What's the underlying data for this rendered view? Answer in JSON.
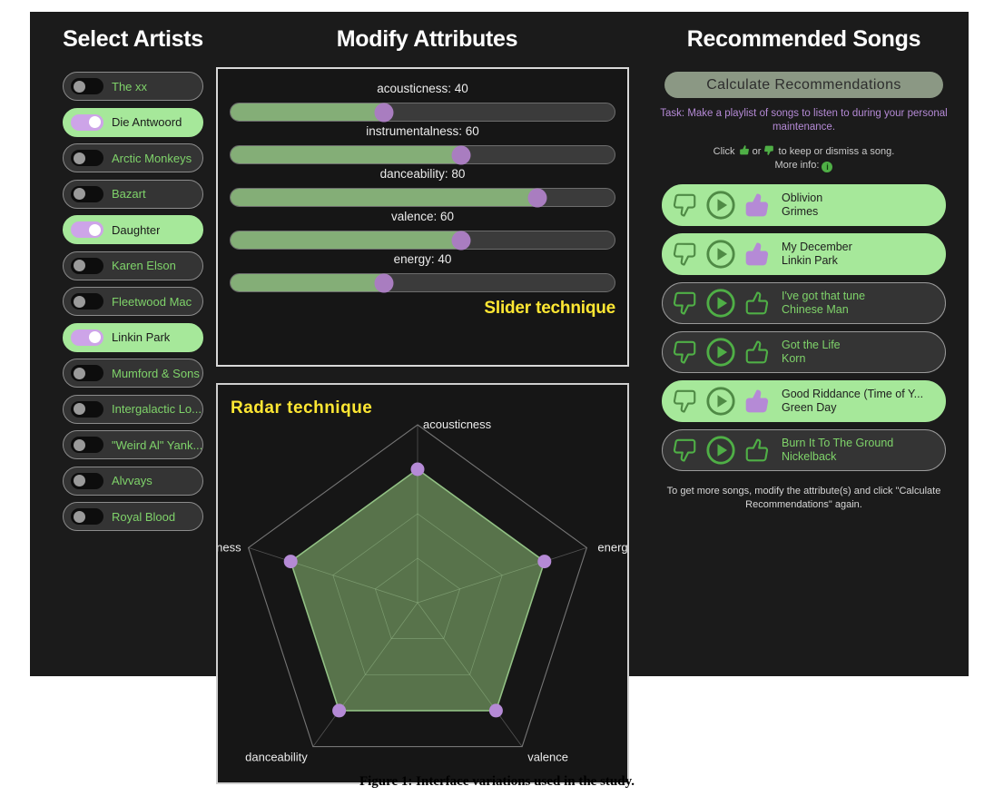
{
  "columns": {
    "artists_title": "Select Artists",
    "attributes_title": "Modify Attributes",
    "recommendations_title": "Recommended Songs"
  },
  "artists": [
    {
      "name": "The xx",
      "selected": false
    },
    {
      "name": "Die Antwoord",
      "selected": true
    },
    {
      "name": "Arctic Monkeys",
      "selected": false
    },
    {
      "name": "Bazart",
      "selected": false
    },
    {
      "name": "Daughter",
      "selected": true
    },
    {
      "name": "Karen Elson",
      "selected": false
    },
    {
      "name": "Fleetwood Mac",
      "selected": false
    },
    {
      "name": "Linkin Park",
      "selected": true
    },
    {
      "name": "Mumford & Sons",
      "selected": false
    },
    {
      "name": "Intergalactic Lo...",
      "selected": false
    },
    {
      "name": "\"Weird Al\" Yank...",
      "selected": false
    },
    {
      "name": "Alvvays",
      "selected": false
    },
    {
      "name": "Royal Blood",
      "selected": false
    }
  ],
  "sliders": {
    "technique_tag": "Slider technique",
    "items": [
      {
        "label": "acousticness: 40",
        "attribute": "acousticness",
        "value": 40
      },
      {
        "label": "instrumentalness: 60",
        "attribute": "instrumentalness",
        "value": 60
      },
      {
        "label": "danceability: 80",
        "attribute": "danceability",
        "value": 80
      },
      {
        "label": "valence: 60",
        "attribute": "valence",
        "value": 60
      },
      {
        "label": "energy: 40",
        "attribute": "energy",
        "value": 40
      }
    ]
  },
  "radar": {
    "technique_tag": "Radar  technique"
  },
  "chart_data": {
    "type": "radar",
    "title": "Radar  technique",
    "categories": [
      "acousticness",
      "energy",
      "valence",
      "danceability",
      "instrumentalness"
    ],
    "values": [
      75,
      75,
      75,
      75,
      75
    ],
    "rings": 4,
    "range": [
      0,
      100
    ],
    "grid": true,
    "legend": "none",
    "fill_color": "#5f7d51",
    "stroke_color": "#8fc080",
    "point_color": "#b58ad6",
    "axis_color": "#7a7a7a"
  },
  "recommendations": {
    "calculate_label": "Calculate Recommendations",
    "task_text": "Task: Make a playlist of songs to listen to during your personal maintenance.",
    "click_help_prefix": "Click",
    "click_help_middle": "or",
    "click_help_suffix": "to keep or dismiss a song.",
    "more_info_label": "More info:",
    "info_glyph": "i",
    "footer_note": "To get more songs, modify the attribute(s) and click \"Calculate Recommendations\" again.",
    "songs": [
      {
        "title": "Oblivion",
        "artist": "Grimes",
        "liked": true
      },
      {
        "title": "My December",
        "artist": "Linkin Park",
        "liked": true
      },
      {
        "title": "I've got that tune",
        "artist": "Chinese Man",
        "liked": false
      },
      {
        "title": "Got the Life",
        "artist": "Korn",
        "liked": false
      },
      {
        "title": "Good Riddance (Time of Y...",
        "artist": "Green Day",
        "liked": true
      },
      {
        "title": "Burn It To The Ground",
        "artist": "Nickelback",
        "liked": false
      }
    ]
  },
  "caption": "Figure 1: Interface variations used in the study.",
  "icons": {
    "thumbs_down": "thumbs-down-icon",
    "play": "play-icon",
    "thumbs_up": "thumbs-up-icon",
    "info": "info-icon"
  },
  "colors": {
    "accent_green": "#a6e89a",
    "text_green": "#7fd36a",
    "purple": "#b58ad6",
    "slider_fill": "#84ae77",
    "yellow_tag": "#ffe733",
    "panel_bg": "#1b1b1b"
  }
}
